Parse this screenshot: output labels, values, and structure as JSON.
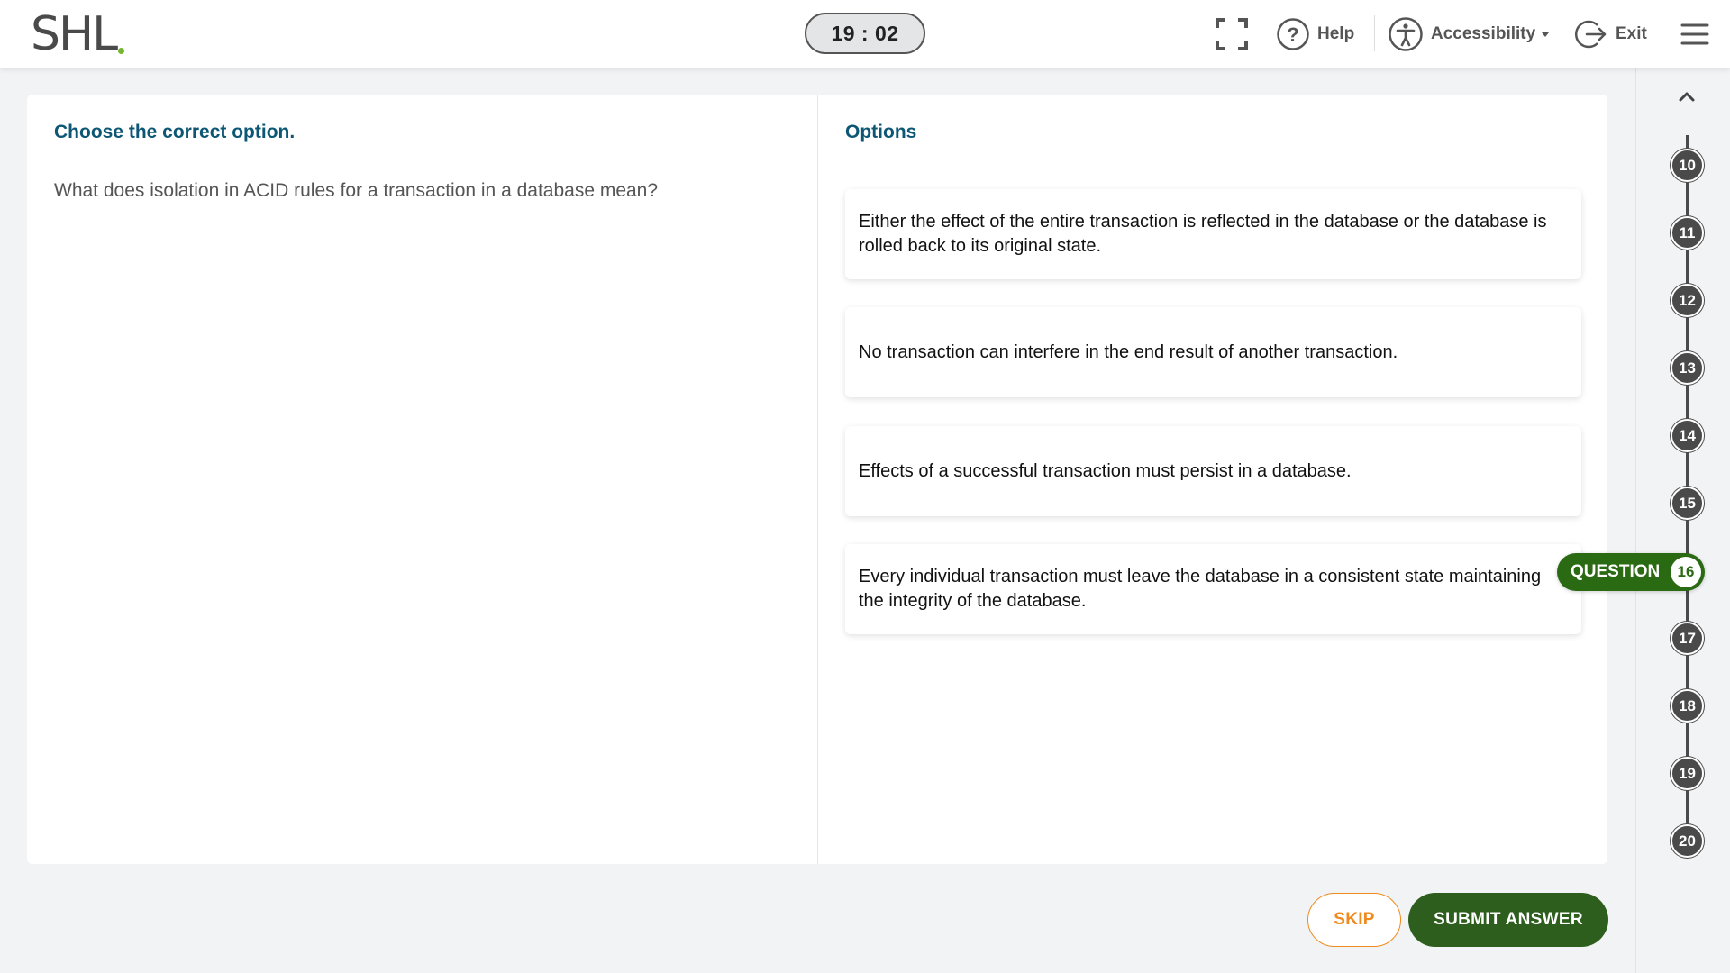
{
  "header": {
    "logo": "SHL",
    "timer": "19 : 02",
    "help_label": "Help",
    "accessibility_label": "Accessibility",
    "exit_label": "Exit"
  },
  "question": {
    "prompt": "Choose the correct option.",
    "text": "What does isolation in ACID rules for a transaction in a database mean?"
  },
  "options": {
    "heading": "Options",
    "items": [
      "Either the effect of the entire transaction is reflected in the database or the database is rolled back to its original state.",
      "No transaction can interfere in the end result of another transaction.",
      "Effects of a successful transaction must persist in a database.",
      "Every individual transaction must leave the database in a consistent state maintaining the integrity of the database."
    ]
  },
  "footer": {
    "skip_label": "SKIP",
    "submit_label": "SUBMIT ANSWER"
  },
  "navigator": {
    "numbers": [
      "10",
      "11",
      "12",
      "13",
      "14",
      "15",
      "17",
      "18",
      "19",
      "20"
    ],
    "current_label": "QUESTION",
    "current_number": "16"
  },
  "colors": {
    "accent_green": "#2e5e1e",
    "skip_orange": "#f08a1c",
    "heading_blue": "#0d5775"
  }
}
